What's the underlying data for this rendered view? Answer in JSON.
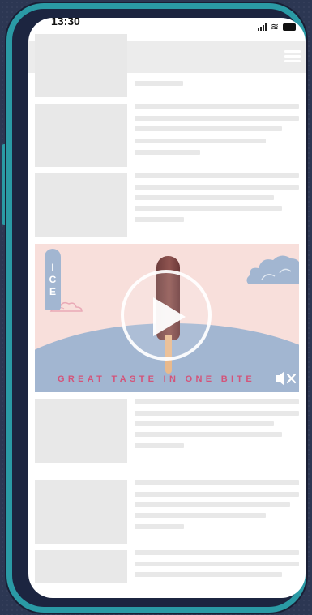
{
  "status_bar": {
    "time": "13:30",
    "signal_icon": "signal-bars-icon",
    "wifi_icon": "wifi-icon",
    "battery_icon": "battery-icon"
  },
  "navbar": {
    "avatar_icon": "avatar-placeholder-icon",
    "menu_icon": "hamburger-menu-icon"
  },
  "ad": {
    "tag_letters": [
      "I",
      "C",
      "E"
    ],
    "slogan": "GREAT TASTE IN ONE BITE",
    "play_icon": "play-icon",
    "mute_icon": "speaker-muted-icon",
    "colors": {
      "background": "#f8dfdb",
      "hill": "#a2b6d1",
      "slogan": "#d3547a",
      "popsicle": "#7d4744"
    }
  }
}
